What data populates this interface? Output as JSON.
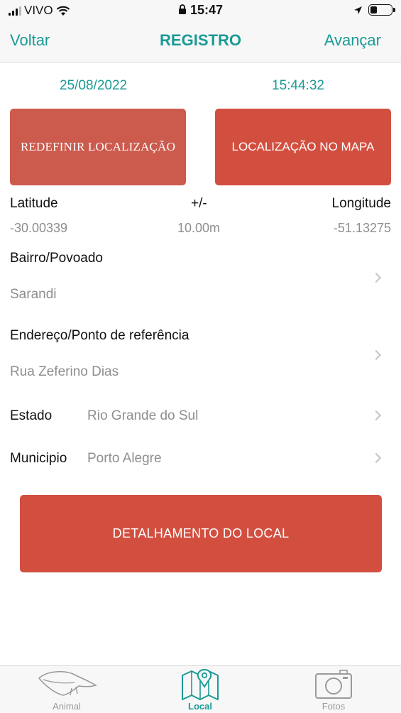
{
  "status_bar": {
    "carrier": "VIVO",
    "time": "15:47"
  },
  "nav": {
    "back_label": "Voltar",
    "title": "REGISTRO",
    "next_label": "Avançar"
  },
  "record": {
    "date": "25/08/2022",
    "time": "15:44:32"
  },
  "buttons": {
    "redefine_location": "REDEFINIR LOCALIZAÇÃO",
    "map_location": "LOCALIZAÇÃO NO MAPA",
    "location_detail": "DETALHAMENTO DO LOCAL"
  },
  "coordinates": {
    "latitude_label": "Latitude",
    "accuracy_label": "+/-",
    "longitude_label": "Longitude",
    "latitude_value": "-30.00339",
    "accuracy_value": "10.00m",
    "longitude_value": "-51.13275"
  },
  "fields": {
    "neighborhood_label": "Bairro/Povoado",
    "neighborhood_value": "Sarandi",
    "address_label": "Endereço/Ponto de referência",
    "address_value": "Rua Zeferino Dias",
    "state_label": "Estado",
    "state_value": "Rio Grande do Sul",
    "city_label": "Municipio",
    "city_value": "Porto Alegre"
  },
  "tabs": [
    {
      "label": "Animal",
      "icon": "anteater-icon",
      "active": false
    },
    {
      "label": "Local",
      "icon": "map-pin-icon",
      "active": true
    },
    {
      "label": "Fotos",
      "icon": "camera-icon",
      "active": false
    }
  ],
  "colors": {
    "accent": "#1a9a96",
    "button_red": "#d24f40",
    "button_red_muted": "#cc5b4e"
  }
}
